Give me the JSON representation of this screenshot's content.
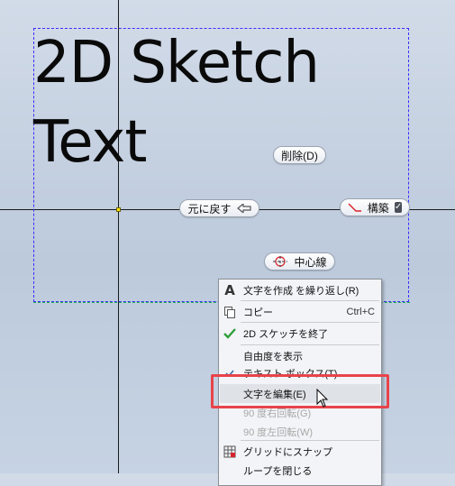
{
  "sketch": {
    "line1": "2D Sketch",
    "line2": "Text"
  },
  "pills": {
    "delete_label": "削除(D)",
    "undo_label": "元に戻す",
    "construction_label": "構築",
    "centerline_label": "中心線"
  },
  "context_menu": {
    "items": [
      {
        "label": "文字を作成 を繰り返し(R)",
        "shortcut": "",
        "icon": "letter-a-icon",
        "enabled": true
      },
      {
        "label": "コピー",
        "shortcut": "Ctrl+C",
        "icon": "copy-icon",
        "enabled": true
      },
      {
        "label": "2D スケッチを終了",
        "shortcut": "",
        "icon": "checkmark-icon",
        "enabled": true
      },
      {
        "label": "自由度を表示",
        "shortcut": "",
        "icon": "",
        "enabled": true
      },
      {
        "label": "テキスト ボックス(T)",
        "shortcut": "",
        "icon": "check-icon",
        "enabled": true
      },
      {
        "label": "文字を編集(E)",
        "shortcut": "",
        "icon": "",
        "enabled": true
      },
      {
        "label": "90 度右回転(G)",
        "shortcut": "",
        "icon": "",
        "enabled": false
      },
      {
        "label": "90 度左回転(W)",
        "shortcut": "",
        "icon": "",
        "enabled": false
      },
      {
        "label": "グリッドにスナップ",
        "shortcut": "",
        "icon": "grid-snap-icon",
        "enabled": true
      },
      {
        "label": "ループを閉じる",
        "shortcut": "",
        "icon": "",
        "enabled": true
      }
    ]
  },
  "colors": {
    "highlight_box": "#e8434a",
    "textbox_border": "#3a2cff",
    "checkmark": "#2e9e3a"
  }
}
